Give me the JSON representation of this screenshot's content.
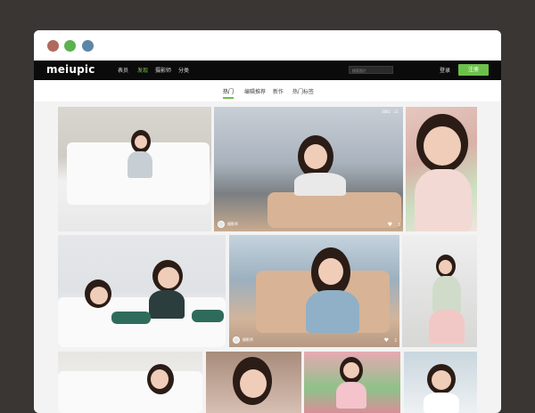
{
  "window": {
    "title": ""
  },
  "nav": {
    "logo": "meiupic",
    "links": [
      "表员",
      "发现",
      "摄影师",
      "分类"
    ],
    "active_index": 1,
    "search_placeholder": "搜索图片",
    "login_label": "登录",
    "register_label": "注册"
  },
  "subnav": {
    "tabs": [
      "热门",
      "编辑推荐",
      "新作",
      "热门标签"
    ],
    "active_index": 0
  },
  "photos": [
    {
      "id": "p1"
    },
    {
      "id": "p2",
      "author": "摄影师",
      "likes": "5",
      "counts": "3801 · 11"
    },
    {
      "id": "p3"
    },
    {
      "id": "p4"
    },
    {
      "id": "p5",
      "author": "摄影师",
      "likes": "5"
    },
    {
      "id": "p6"
    },
    {
      "id": "p7"
    },
    {
      "id": "p8"
    },
    {
      "id": "p9"
    },
    {
      "id": "p10"
    }
  ],
  "colors": {
    "background": "#3a3634",
    "navbar": "#0b0b0b",
    "accent_green": "#6cc04a",
    "gallery_bg": "#f3f3f3",
    "dot_red": "#b06a5c",
    "dot_green": "#5bb24e",
    "dot_blue": "#5c86a8"
  },
  "icons": [
    "heart-icon",
    "avatar-icon",
    "search-icon"
  ]
}
